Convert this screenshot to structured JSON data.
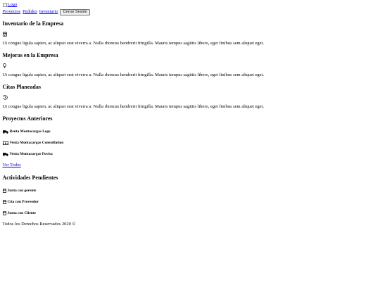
{
  "header": {
    "logo_alt": "Logo",
    "nav": [
      {
        "label": "Proyectos"
      },
      {
        "label": "Pedidos"
      },
      {
        "label": "Inventario"
      }
    ],
    "logout_label": "Cerrar Sesión"
  },
  "sections": [
    {
      "title": "Inventario de la Empresa",
      "icon": "calendar-check-icon",
      "text": "Ut congue ligula sapien, ac aliquet erat viverra a. Nulla rhoncus hendrerit fringilla. Mauris tempus sagittis libero, eget finibus sem aliquet eget."
    },
    {
      "title": "Mejoras en la Empresa",
      "icon": "lightbulb-icon",
      "text": "Ut congue ligula sapien, ac aliquet erat viverra a. Nulla rhoncus hendrerit fringilla. Mauris tempus sagittis libero, eget finibus sem aliquet eget."
    },
    {
      "title": "Citas Planeadas",
      "icon": "history-icon",
      "text": "Ut congue ligula sapien, ac aliquet erat viverra a. Nulla rhoncus hendrerit fringilla. Mauris tempus sagittis libero, eget finibus sem aliquet eget."
    }
  ],
  "projects": {
    "title": "Proyectos Anteriores",
    "items": [
      {
        "label": "Renta Montacargas Lego",
        "icon": "truck-icon"
      },
      {
        "label": "Venta Montacargas Constellation",
        "icon": "money-bill-icon"
      },
      {
        "label": "Venta Montacargas Fovisa",
        "icon": "truck-icon"
      }
    ],
    "link_label": "Ver Todos"
  },
  "activities": {
    "title": "Actividades Pendientes",
    "items": [
      {
        "label": "Junta con gerente",
        "icon": "calendar-icon"
      },
      {
        "label": "Cita con Proveedor",
        "icon": "calendar-icon"
      },
      {
        "label": "Junta con Cliente",
        "icon": "calendar-icon"
      }
    ]
  },
  "footer": {
    "text": "Todos los Derechos Reservados 2020 ©"
  }
}
